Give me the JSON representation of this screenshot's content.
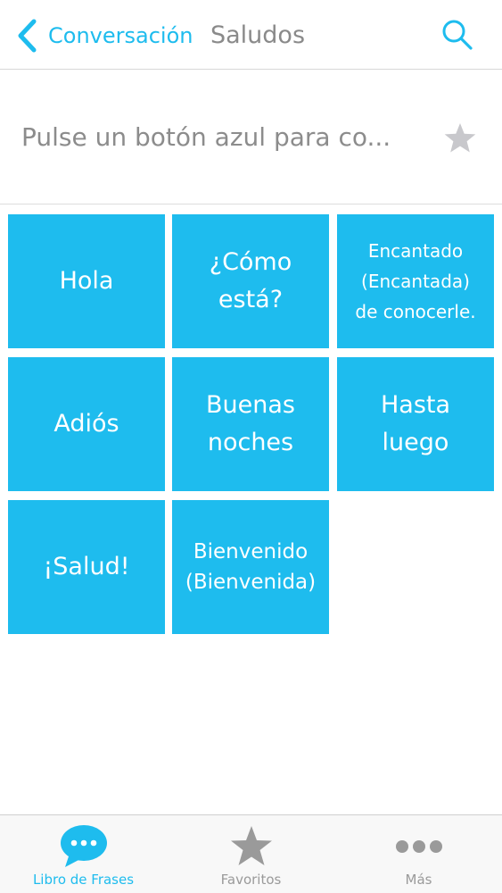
{
  "header": {
    "back_label": "Conversación",
    "title": "Saludos"
  },
  "phrase_display": {
    "text": "Pulse un botón azul para co..."
  },
  "phrases": [
    {
      "label": "Hola"
    },
    {
      "label": "¿Cómo\nestá?"
    },
    {
      "label": "Encantado\n(Encantada)\nde conocerle."
    },
    {
      "label": "Adiós"
    },
    {
      "label": "Buenas\nnoches"
    },
    {
      "label": "Hasta\nluego"
    },
    {
      "label": "¡Salud!"
    },
    {
      "label": "Bienvenido\n(Bienvenida)"
    }
  ],
  "tab_bar": {
    "tabs": [
      {
        "label": "Libro de Frases",
        "icon": "speech-bubble-icon",
        "active": true
      },
      {
        "label": "Favoritos",
        "icon": "star-icon",
        "active": false
      },
      {
        "label": "Más",
        "icon": "more-dots-icon",
        "active": false
      }
    ]
  },
  "colors": {
    "accent": "#1ebcee",
    "tile_text": "#ffffff",
    "muted_text": "#8a8a8a",
    "star_inactive": "#c8c8cc",
    "tab_icon_inactive": "#9a9a9a"
  }
}
